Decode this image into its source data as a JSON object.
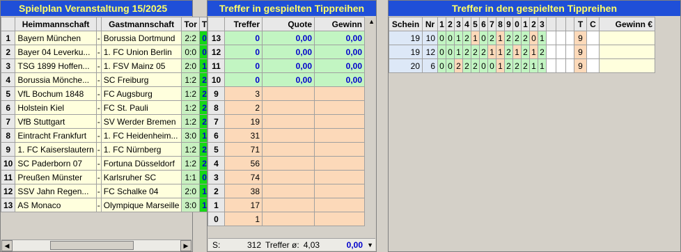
{
  "spielplan": {
    "title": "Spielplan Veranstaltung 15/2025",
    "headers": {
      "heim": "Heimmannschaft",
      "gast": "Gastmannschaft",
      "tor": "Tor",
      "tip": "T"
    },
    "rows": [
      {
        "nr": "1",
        "heim": "Bayern München",
        "sep": "-",
        "gast": "Borussia Dortmund",
        "tor": "2:2",
        "tip": "0"
      },
      {
        "nr": "2",
        "heim": "Bayer 04 Leverku...",
        "sep": "-",
        "gast": "1. FC Union Berlin",
        "tor": "0:0",
        "tip": "0"
      },
      {
        "nr": "3",
        "heim": "TSG 1899 Hoffen...",
        "sep": "-",
        "gast": "1. FSV Mainz 05",
        "tor": "2:0",
        "tip": "1"
      },
      {
        "nr": "4",
        "heim": "Borussia Mönche...",
        "sep": "-",
        "gast": "SC Freiburg",
        "tor": "1:2",
        "tip": "2"
      },
      {
        "nr": "5",
        "heim": "VfL Bochum 1848",
        "sep": "-",
        "gast": "FC Augsburg",
        "tor": "1:2",
        "tip": "2"
      },
      {
        "nr": "6",
        "heim": "Holstein Kiel",
        "sep": "-",
        "gast": "FC St. Pauli",
        "tor": "1:2",
        "tip": "2"
      },
      {
        "nr": "7",
        "heim": "VfB Stuttgart",
        "sep": "-",
        "gast": "SV Werder Bremen",
        "tor": "1:2",
        "tip": "2"
      },
      {
        "nr": "8",
        "heim": "Eintracht Frankfurt",
        "sep": "-",
        "gast": "1. FC Heidenheim...",
        "tor": "3:0",
        "tip": "1"
      },
      {
        "nr": "9",
        "heim": "1. FC Kaiserslautern",
        "sep": "-",
        "gast": "1. FC Nürnberg",
        "tor": "1:2",
        "tip": "2"
      },
      {
        "nr": "10",
        "heim": "SC Paderborn 07",
        "sep": "-",
        "gast": "Fortuna Düsseldorf",
        "tor": "1:2",
        "tip": "2"
      },
      {
        "nr": "11",
        "heim": "Preußen Münster",
        "sep": "-",
        "gast": "Karlsruher SC",
        "tor": "1:1",
        "tip": "0"
      },
      {
        "nr": "12",
        "heim": "SSV Jahn Regen...",
        "sep": "-",
        "gast": "FC Schalke 04",
        "tor": "2:0",
        "tip": "1"
      },
      {
        "nr": "13",
        "heim": "AS Monaco",
        "sep": "-",
        "gast": "Olympique Marseille",
        "tor": "3:0",
        "tip": "1"
      }
    ]
  },
  "treffer": {
    "title": "Treffer in gespielten Tippreihen",
    "headers": {
      "treffer": "Treffer",
      "quote": "Quote",
      "gewinn": "Gewinn"
    },
    "rows": [
      {
        "r": "13",
        "treffer": "0",
        "quote": "0,00",
        "gewinn": "0,00",
        "win": true
      },
      {
        "r": "12",
        "treffer": "0",
        "quote": "0,00",
        "gewinn": "0,00",
        "win": true
      },
      {
        "r": "11",
        "treffer": "0",
        "quote": "0,00",
        "gewinn": "0,00",
        "win": true
      },
      {
        "r": "10",
        "treffer": "0",
        "quote": "0,00",
        "gewinn": "0,00",
        "win": true
      },
      {
        "r": "9",
        "treffer": "3",
        "quote": "",
        "gewinn": "",
        "win": false
      },
      {
        "r": "8",
        "treffer": "2",
        "quote": "",
        "gewinn": "",
        "win": false
      },
      {
        "r": "7",
        "treffer": "19",
        "quote": "",
        "gewinn": "",
        "win": false
      },
      {
        "r": "6",
        "treffer": "31",
        "quote": "",
        "gewinn": "",
        "win": false
      },
      {
        "r": "5",
        "treffer": "71",
        "quote": "",
        "gewinn": "",
        "win": false
      },
      {
        "r": "4",
        "treffer": "56",
        "quote": "",
        "gewinn": "",
        "win": false
      },
      {
        "r": "3",
        "treffer": "74",
        "quote": "",
        "gewinn": "",
        "win": false
      },
      {
        "r": "2",
        "treffer": "38",
        "quote": "",
        "gewinn": "",
        "win": false
      },
      {
        "r": "1",
        "treffer": "17",
        "quote": "",
        "gewinn": "",
        "win": false
      },
      {
        "r": "0",
        "treffer": "1",
        "quote": "",
        "gewinn": "",
        "win": false
      }
    ],
    "footer": {
      "s_label": "S:",
      "sum": "312",
      "avg_label": "Treffer ø:",
      "avg": "4,03",
      "gewinn": "0,00"
    }
  },
  "tippreihen": {
    "title": "Treffer in den gespielten Tippreihen",
    "headers": {
      "schein": "Schein",
      "nr": "Nr",
      "cols": [
        "1",
        "2",
        "3",
        "4",
        "5",
        "6",
        "7",
        "8",
        "9",
        "0",
        "1",
        "2",
        "3"
      ],
      "t": "T",
      "c": "C",
      "gewinn": "Gewinn €"
    },
    "rows": [
      {
        "schein": "19",
        "nr": "10",
        "tips": [
          "0",
          "0",
          "1",
          "2",
          "1",
          "0",
          "2",
          "1",
          "2",
          "2",
          "2",
          "0",
          "1"
        ],
        "t": "9",
        "c": ""
      },
      {
        "schein": "19",
        "nr": "12",
        "tips": [
          "0",
          "0",
          "1",
          "2",
          "2",
          "2",
          "1",
          "1",
          "2",
          "1",
          "2",
          "1",
          "2"
        ],
        "t": "9",
        "c": ""
      },
      {
        "schein": "20",
        "nr": "6",
        "tips": [
          "0",
          "0",
          "2",
          "2",
          "2",
          "0",
          "0",
          "1",
          "2",
          "2",
          "2",
          "1",
          "1"
        ],
        "t": "9",
        "c": ""
      }
    ],
    "hits": [
      [
        1,
        1,
        1,
        1,
        0,
        1,
        1,
        0,
        1,
        1,
        1,
        0,
        1
      ],
      [
        1,
        1,
        1,
        1,
        1,
        1,
        0,
        0,
        1,
        0,
        1,
        0,
        1
      ],
      [
        1,
        1,
        0,
        1,
        1,
        1,
        1,
        0,
        1,
        1,
        1,
        1,
        1
      ]
    ]
  }
}
